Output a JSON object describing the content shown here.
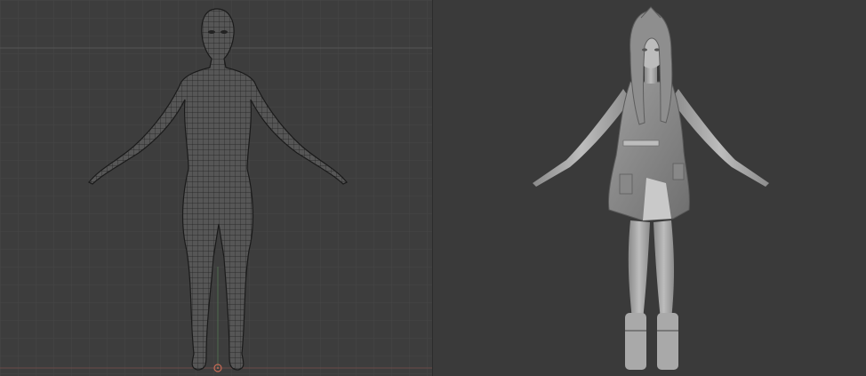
{
  "viewports": {
    "left": {
      "label": "wireframe-view",
      "background": "#3d3d3d",
      "grid_color": "#454545",
      "mesh_color": "#1c1c1c",
      "body_color": "#5a5a5a"
    },
    "right": {
      "label": "sculpt-view",
      "background": "#3a3a3a",
      "model_light": "#b9b9b9",
      "model_dark": "#6e6e6e"
    }
  },
  "icons": {
    "origin": "origin-marker-icon"
  }
}
